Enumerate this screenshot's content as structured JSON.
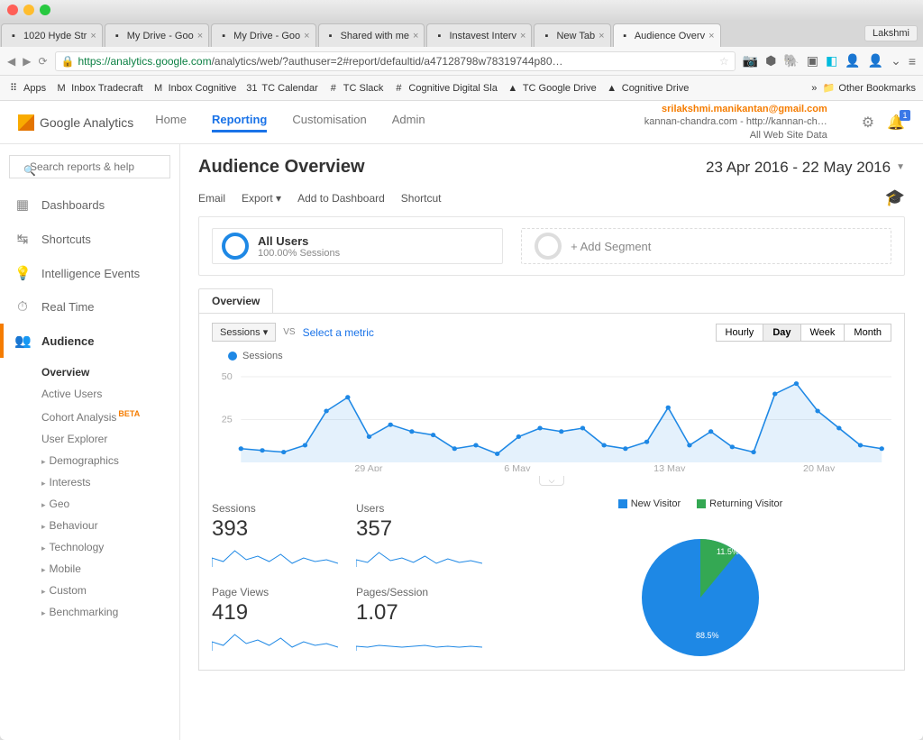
{
  "browser": {
    "user_pill": "Lakshmi",
    "tabs": [
      {
        "label": "1020 Hyde Str"
      },
      {
        "label": "My Drive - Goo"
      },
      {
        "label": "My Drive - Goo"
      },
      {
        "label": "Shared with me"
      },
      {
        "label": "Instavest Interv"
      },
      {
        "label": "New Tab"
      },
      {
        "label": "Audience Overv",
        "active": true
      }
    ],
    "url_host": "https://analytics.google.com",
    "url_path": "/analytics/web/?authuser=2#report/defaultid/a47128798w78319744p80…",
    "bookmarks": [
      {
        "label": "Apps"
      },
      {
        "label": "Inbox Tradecraft"
      },
      {
        "label": "Inbox Cognitive"
      },
      {
        "label": "TC Calendar"
      },
      {
        "label": "TC Slack"
      },
      {
        "label": "Cognitive Digital Sla"
      },
      {
        "label": "TC Google Drive"
      },
      {
        "label": "Cognitive Drive"
      }
    ],
    "other_bookmarks": "Other Bookmarks"
  },
  "ga": {
    "logo": "Google Analytics",
    "nav": [
      {
        "label": "Home"
      },
      {
        "label": "Reporting",
        "active": true
      },
      {
        "label": "Customisation"
      },
      {
        "label": "Admin"
      }
    ],
    "account": {
      "email": "srilakshmi.manikantan@gmail.com",
      "property": "kannan-chandra.com - http://kannan-ch…",
      "view": "All Web Site Data"
    }
  },
  "sidebar": {
    "search_placeholder": "Search reports & help",
    "groups": [
      {
        "label": "Dashboards",
        "icon": "▦"
      },
      {
        "label": "Shortcuts",
        "icon": "↹"
      },
      {
        "label": "Intelligence Events",
        "icon": "💡"
      },
      {
        "label": "Real Time",
        "icon": "⏱"
      },
      {
        "label": "Audience",
        "icon": "👥",
        "active": true
      }
    ],
    "audience_sub": [
      {
        "label": "Overview",
        "bold": true
      },
      {
        "label": "Active Users"
      },
      {
        "label": "Cohort Analysis",
        "beta": "BETA"
      },
      {
        "label": "User Explorer"
      },
      {
        "label": "Demographics",
        "expand": true
      },
      {
        "label": "Interests",
        "expand": true
      },
      {
        "label": "Geo",
        "expand": true
      },
      {
        "label": "Behaviour",
        "expand": true
      },
      {
        "label": "Technology",
        "expand": true
      },
      {
        "label": "Mobile",
        "expand": true
      },
      {
        "label": "Custom",
        "expand": true
      },
      {
        "label": "Benchmarking",
        "expand": true
      }
    ]
  },
  "page": {
    "title": "Audience Overview",
    "date_range": "23 Apr 2016 - 22 May 2016",
    "actions": [
      "Email",
      "Export ▾",
      "Add to Dashboard",
      "Shortcut"
    ],
    "segments": {
      "primary": {
        "name": "All Users",
        "sub": "100.00% Sessions"
      },
      "add": "+ Add Segment"
    },
    "tab_label": "Overview",
    "metric_dd": "Sessions",
    "vs": "VS",
    "select_metric": "Select a metric",
    "time_toggles": [
      "Hourly",
      "Day",
      "Week",
      "Month"
    ],
    "time_active": "Day",
    "chart_series_label": "Sessions",
    "stats": [
      {
        "label": "Sessions",
        "value": "393"
      },
      {
        "label": "Users",
        "value": "357"
      },
      {
        "label": "Page Views",
        "value": "419"
      },
      {
        "label": "Pages/Session",
        "value": "1.07"
      }
    ],
    "pie_legend": [
      {
        "label": "New Visitor",
        "color": "sw-blue"
      },
      {
        "label": "Returning Visitor",
        "color": "sw-green"
      }
    ]
  },
  "chart_data": {
    "type": "line",
    "title": "Sessions",
    "ylabel": "",
    "xlabel": "",
    "ylim": [
      0,
      50
    ],
    "x_ticks": [
      "29 Apr",
      "6 May",
      "13 May",
      "20 May"
    ],
    "values": [
      8,
      7,
      6,
      10,
      30,
      38,
      15,
      22,
      18,
      16,
      8,
      10,
      5,
      15,
      20,
      18,
      20,
      10,
      8,
      12,
      32,
      10,
      18,
      9,
      6,
      40,
      46,
      30,
      20,
      10,
      8
    ],
    "pie": {
      "new_visitor": 88.5,
      "returning_visitor": 11.5
    }
  }
}
